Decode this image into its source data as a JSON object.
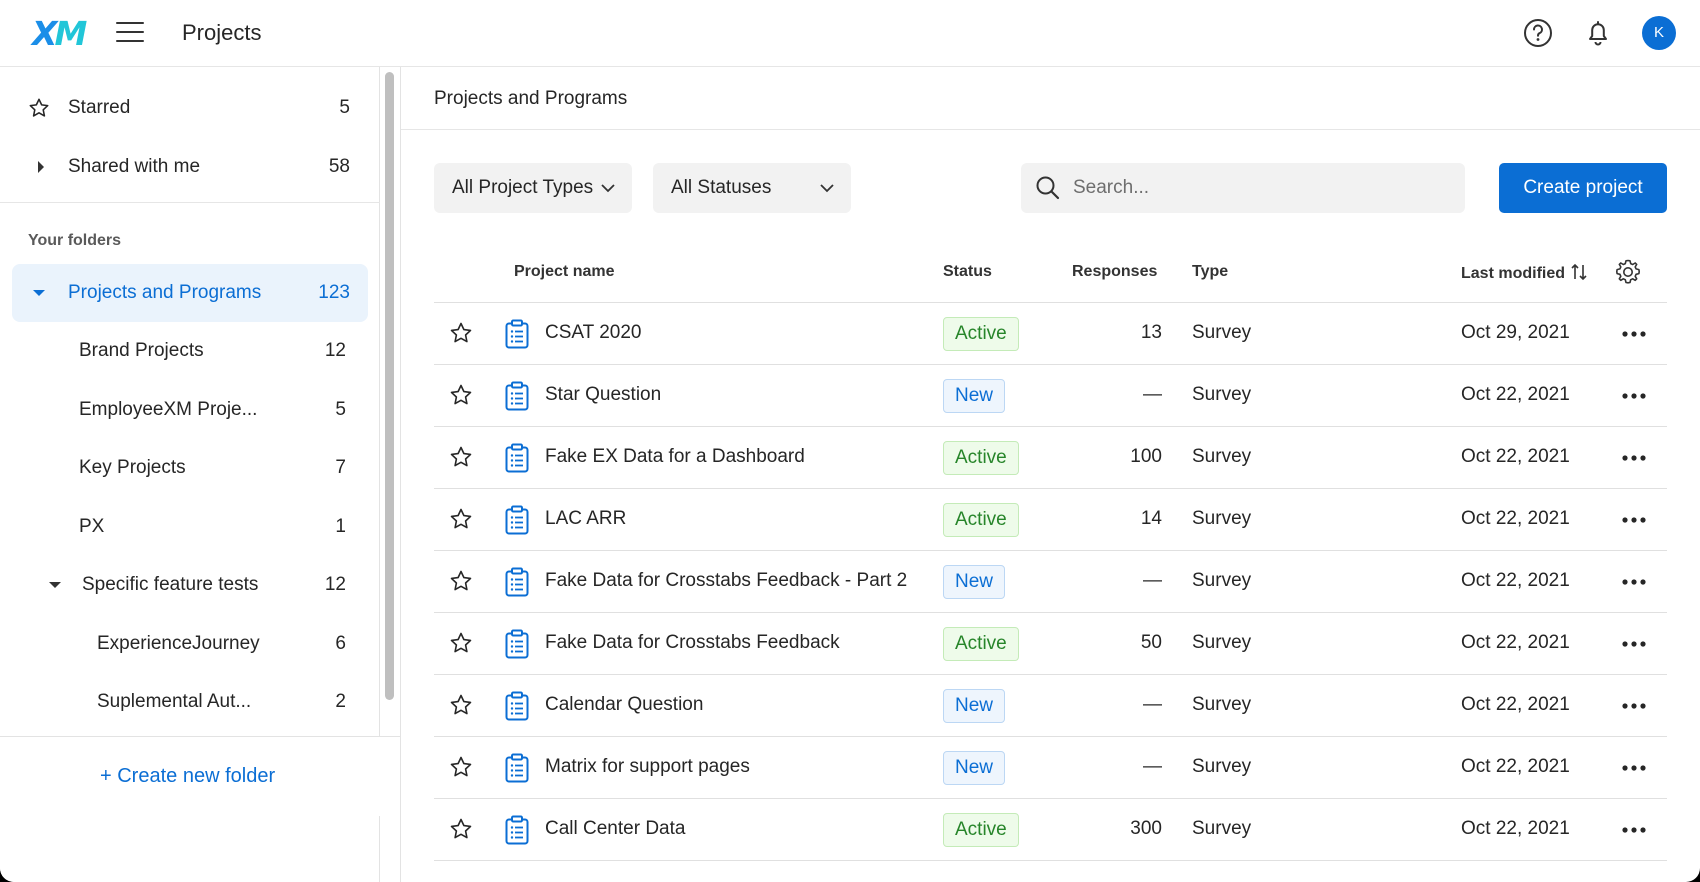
{
  "header": {
    "logo_x": "X",
    "logo_m": "M",
    "title": "Projects",
    "avatar_initial": "K"
  },
  "sidebar": {
    "starred": {
      "label": "Starred",
      "count": "5"
    },
    "shared": {
      "label": "Shared with me",
      "count": "58"
    },
    "section_title": "Your folders",
    "folders": [
      {
        "label": "Projects and Programs",
        "count": "123"
      },
      {
        "label": "Brand Projects",
        "count": "12"
      },
      {
        "label": "EmployeeXM Proje...",
        "count": "5"
      },
      {
        "label": "Key Projects",
        "count": "7"
      },
      {
        "label": "PX",
        "count": "1"
      },
      {
        "label": "Specific feature tests",
        "count": "12"
      },
      {
        "label": "ExperienceJourney",
        "count": "6"
      },
      {
        "label": "Suplemental Aut...",
        "count": "2"
      }
    ],
    "create_folder": "+ Create new folder"
  },
  "main": {
    "breadcrumb": "Projects and Programs",
    "filters": {
      "project_types": "All Project Types",
      "statuses": "All Statuses"
    },
    "search_placeholder": "Search...",
    "create_button": "Create project",
    "columns": {
      "name": "Project name",
      "status": "Status",
      "responses": "Responses",
      "type": "Type",
      "last_modified": "Last modified"
    },
    "rows": [
      {
        "name": "CSAT 2020",
        "status": "Active",
        "responses": "13",
        "type": "Survey",
        "date": "Oct 29, 2021"
      },
      {
        "name": "Star Question",
        "status": "New",
        "responses": "—",
        "type": "Survey",
        "date": "Oct 22, 2021"
      },
      {
        "name": "Fake EX Data for a Dashboard",
        "status": "Active",
        "responses": "100",
        "type": "Survey",
        "date": "Oct 22, 2021"
      },
      {
        "name": "LAC ARR",
        "status": "Active",
        "responses": "14",
        "type": "Survey",
        "date": "Oct 22, 2021"
      },
      {
        "name": "Fake Data for Crosstabs Feedback - Part 2",
        "status": "New",
        "responses": "—",
        "type": "Survey",
        "date": "Oct 22, 2021"
      },
      {
        "name": "Fake Data for Crosstabs Feedback",
        "status": "Active",
        "responses": "50",
        "type": "Survey",
        "date": "Oct 22, 2021"
      },
      {
        "name": "Calendar Question",
        "status": "New",
        "responses": "—",
        "type": "Survey",
        "date": "Oct 22, 2021"
      },
      {
        "name": "Matrix for support pages",
        "status": "New",
        "responses": "—",
        "type": "Survey",
        "date": "Oct 22, 2021"
      },
      {
        "name": "Call Center Data",
        "status": "Active",
        "responses": "300",
        "type": "Survey",
        "date": "Oct 22, 2021"
      }
    ]
  },
  "colors": {
    "accent": "#0b6ed4",
    "active_green": "#27852a",
    "logo_blue": "#1b8ee8",
    "logo_cyan": "#21c6d8"
  },
  "icons": [
    "star-icon",
    "chevron-right-icon",
    "caret-down-icon",
    "menu-icon",
    "help-icon",
    "bell-icon",
    "search-icon",
    "gear-icon",
    "clipboard-icon",
    "more-icon",
    "sort-icon"
  ]
}
